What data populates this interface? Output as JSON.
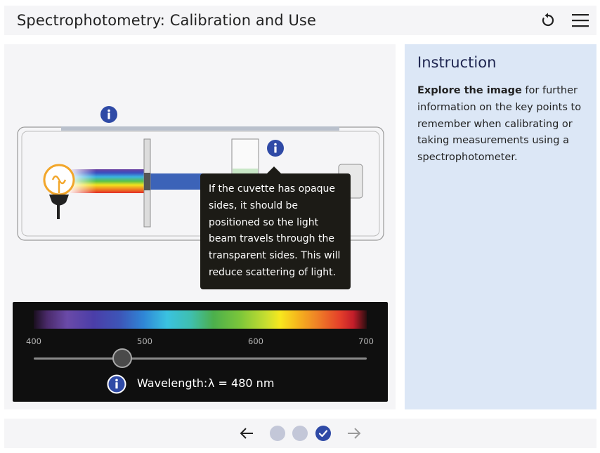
{
  "header": {
    "title": "Spectrophotometry: Calibration and Use"
  },
  "instruction": {
    "title": "Instruction",
    "body_bold": "Explore the image",
    "body_rest": " for further information on the key points to remember when calibrating or taking measurements using a spectrophotometer."
  },
  "tooltip": {
    "text": "If the cuvette has opaque sides, it should be positioned so the light beam travels through the transparent sides. This will reduce scattering of light."
  },
  "spectrum": {
    "ticks": [
      "400",
      "500",
      "600",
      "700"
    ],
    "wavelength_label": "Wavelength:",
    "wavelength_value": "λ = 480 nm",
    "min_nm": 400,
    "max_nm": 700,
    "current_nm": 480
  },
  "footer": {
    "steps": [
      {
        "state": "done"
      },
      {
        "state": "done"
      },
      {
        "state": "current"
      }
    ]
  },
  "colors": {
    "accent": "#2f4aa6",
    "panel_bg": "#f5f5f7",
    "instruction_bg": "#dce7f6",
    "tooltip_bg": "#1c1b16",
    "spectrum_bg": "#0f0f0f"
  }
}
